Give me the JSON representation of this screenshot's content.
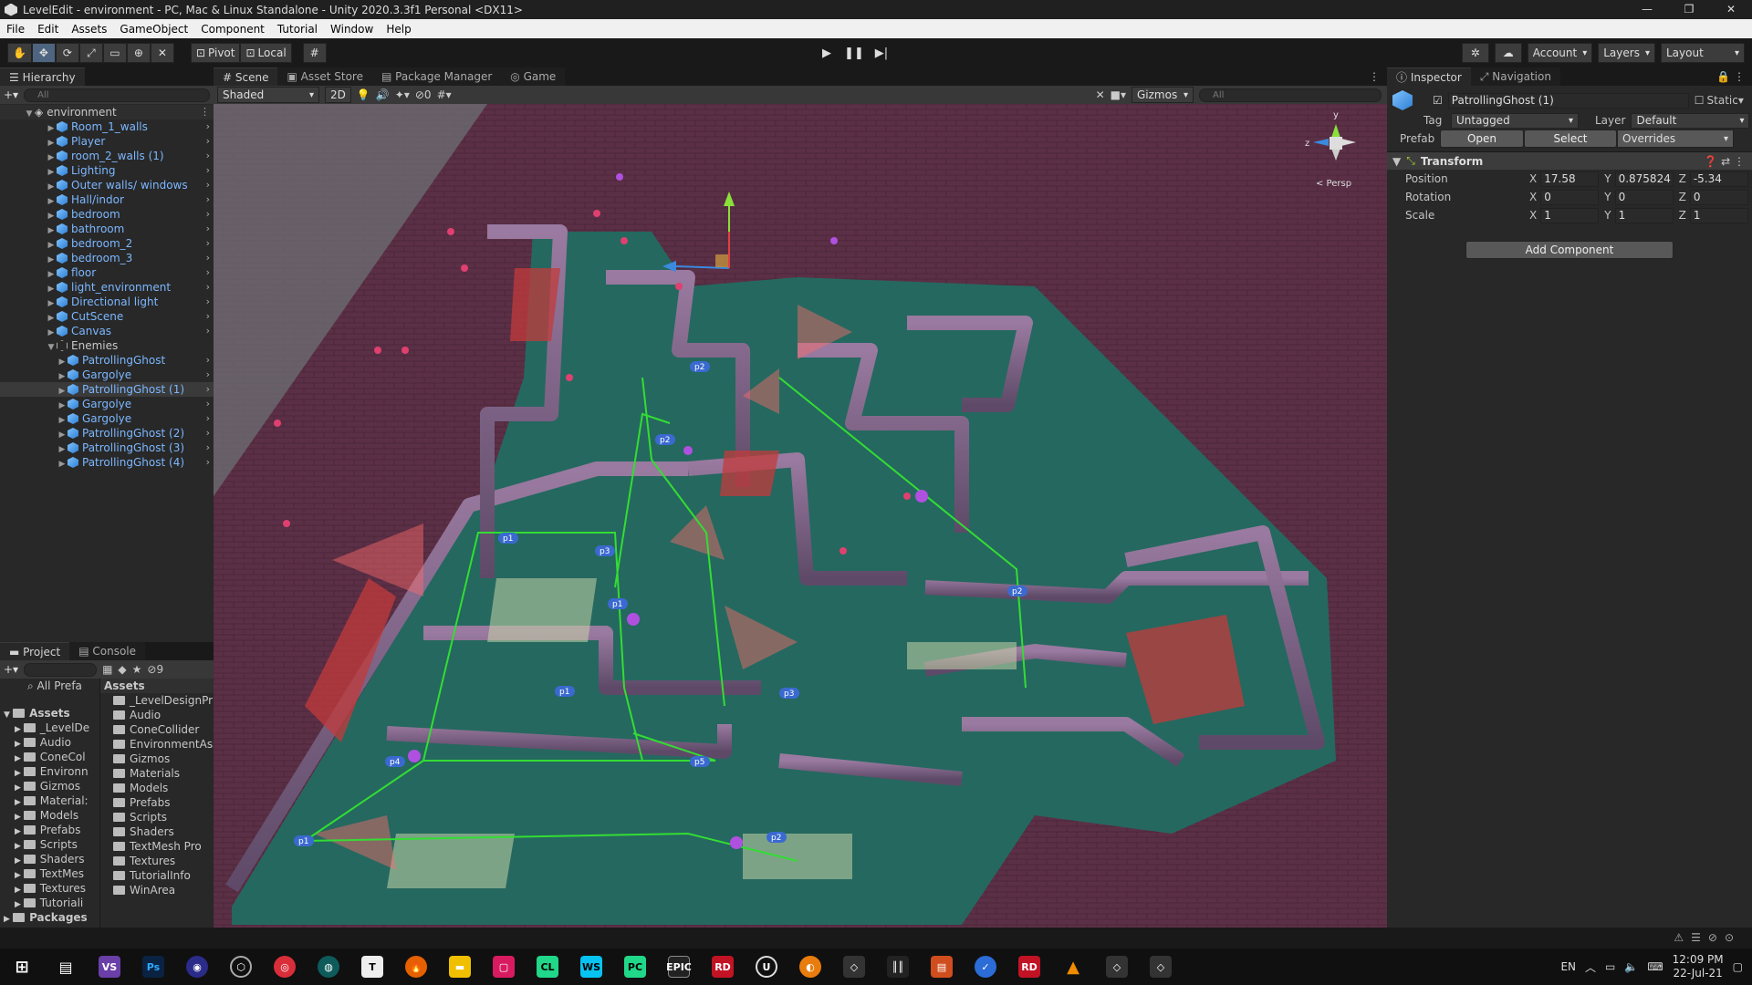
{
  "window": {
    "title": "LevelEdit - environment - PC, Mac & Linux Standalone - Unity 2020.3.3f1 Personal <DX11>"
  },
  "menu": [
    "File",
    "Edit",
    "Assets",
    "GameObject",
    "Component",
    "Tutorial",
    "Window",
    "Help"
  ],
  "toolbar": {
    "pivot": "Pivot",
    "local": "Local",
    "account": "Account",
    "layers": "Layers",
    "layout": "Layout"
  },
  "hierarchy": {
    "tab": "Hierarchy",
    "search_placeholder": "All",
    "scene": "environment",
    "items": [
      {
        "label": "Room_1_walls",
        "depth": 1
      },
      {
        "label": "Player",
        "depth": 1
      },
      {
        "label": "room_2_walls (1)",
        "depth": 1
      },
      {
        "label": "Lighting",
        "depth": 1
      },
      {
        "label": "Outer walls/ windows",
        "depth": 1
      },
      {
        "label": "Hall/indor",
        "depth": 1
      },
      {
        "label": "bedroom",
        "depth": 1
      },
      {
        "label": "bathroom",
        "depth": 1
      },
      {
        "label": "bedroom_2",
        "depth": 1
      },
      {
        "label": "bedroom_3",
        "depth": 1
      },
      {
        "label": "floor",
        "depth": 1
      },
      {
        "label": "light_environment",
        "depth": 1
      },
      {
        "label": "Directional light",
        "depth": 1
      },
      {
        "label": "CutScene",
        "depth": 1
      },
      {
        "label": "Canvas",
        "depth": 1
      },
      {
        "label": "Enemies",
        "depth": 1
      },
      {
        "label": "PatrollingGhost",
        "depth": 2
      },
      {
        "label": "Gargolye",
        "depth": 2
      },
      {
        "label": "PatrollingGhost (1)",
        "depth": 2
      },
      {
        "label": "Gargolye",
        "depth": 2
      },
      {
        "label": "Gargolye",
        "depth": 2
      },
      {
        "label": "PatrollingGhost (2)",
        "depth": 2
      },
      {
        "label": "PatrollingGhost (3)",
        "depth": 2
      },
      {
        "label": "PatrollingGhost (4)",
        "depth": 2
      }
    ]
  },
  "project": {
    "tab_project": "Project",
    "tab_console": "Console",
    "count_badge": "9",
    "all_prefabs": "All Prefa",
    "assets_header": "Assets",
    "left_tree": [
      "Assets",
      "_LevelDe",
      "Audio",
      "ConeCol",
      "Environn",
      "Gizmos",
      "Material:",
      "Models",
      "Prefabs",
      "Scripts",
      "Shaders",
      "TextMes",
      "Textures",
      "Tutoriali",
      "Packages"
    ],
    "folders": [
      "_LevelDesignPr",
      "Audio",
      "ConeCollider",
      "EnvironmentAss",
      "Gizmos",
      "Materials",
      "Models",
      "Prefabs",
      "Scripts",
      "Shaders",
      "TextMesh Pro",
      "Textures",
      "TutorialInfo",
      "WinArea"
    ]
  },
  "scene": {
    "tabs": [
      "Scene",
      "Asset Store",
      "Package Manager",
      "Game"
    ],
    "shading": "Shaded",
    "mode_2d": "2D",
    "hidden_count": "0",
    "gizmos": "Gizmos",
    "search_placeholder": "All",
    "persp": "< Persp",
    "axis_y": "y",
    "axis_z": "z",
    "waypoints": [
      "p1",
      "p2",
      "p3",
      "p1",
      "p2",
      "p1",
      "p2",
      "p3",
      "p4",
      "p5",
      "p1",
      "p2"
    ]
  },
  "inspector": {
    "tabs": [
      "Inspector",
      "Navigation"
    ],
    "object_name": "PatrollingGhost (1)",
    "static_label": "Static",
    "tag_label": "Tag",
    "tag_value": "Untagged",
    "layer_label": "Layer",
    "layer_value": "Default",
    "prefab_label": "Prefab",
    "open": "Open",
    "select": "Select",
    "overrides": "Overrides",
    "component": "Transform",
    "position_label": "Position",
    "rotation_label": "Rotation",
    "scale_label": "Scale",
    "position": {
      "x": "17.58",
      "y": "0.875824",
      "z": "-5.34"
    },
    "rotation": {
      "x": "0",
      "y": "0",
      "z": "0"
    },
    "scale": {
      "x": "1",
      "y": "1",
      "z": "1"
    },
    "add_component": "Add Component"
  },
  "taskbar": {
    "lang": "EN",
    "time": "12:09 PM",
    "date": "22-Jul-21"
  },
  "colors": {
    "selection": "#4d6580",
    "link_blue": "#7cb7ff",
    "scene_floor": "#5a3044",
    "wall_teal": "#2b7a72",
    "path_green": "#33dd33"
  }
}
